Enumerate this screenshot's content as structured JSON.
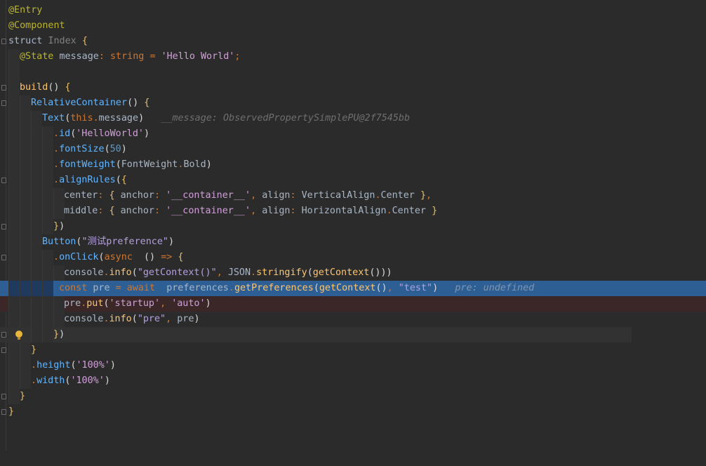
{
  "editor": {
    "file_lines": [
      "@Entry",
      "@Component",
      "struct Index {",
      "@State message: string = 'Hello World';",
      "",
      "build() {",
      "RelativeContainer() {",
      "Text(this.message)",
      ".id('HelloWorld')",
      ".fontSize(50)",
      ".fontWeight(FontWeight.Bold)",
      ".alignRules({",
      "center: { anchor: '__container__', align: VerticalAlign.Center },",
      "middle: { anchor: '__container__', align: HorizontalAlign.Center }",
      "})",
      "Button(\"测试preference\")",
      ".onClick(async  () => {",
      "console.info(\"getContext()\", JSON.stringify(getContext()))",
      "const pre = await  preferences.getPreferences(getContext(), \"test\")",
      "pre.put('startup', 'auto')",
      "console.info(\"pre\", pre)",
      "})",
      "}",
      ".height('100%')",
      ".width('100%')",
      "}",
      "}"
    ],
    "inline_hints": {
      "message_hint": "__message: ObservedPropertySimplePU@2f7545bb",
      "pre_hint": "pre: undefined"
    },
    "highlight_colors": {
      "execution_line": "#2d5e94",
      "error_line": "#3b2727",
      "annotation": "#bbb529",
      "keyword": "#cc7832",
      "string_single": "#d0a0d8",
      "string_double": "#b5a0e0",
      "number": "#6897bb",
      "function": "#ffc66d"
    },
    "gutter_icons": {
      "fold_marker": "fold-marker-icon",
      "intention": "lightbulb-icon"
    }
  }
}
